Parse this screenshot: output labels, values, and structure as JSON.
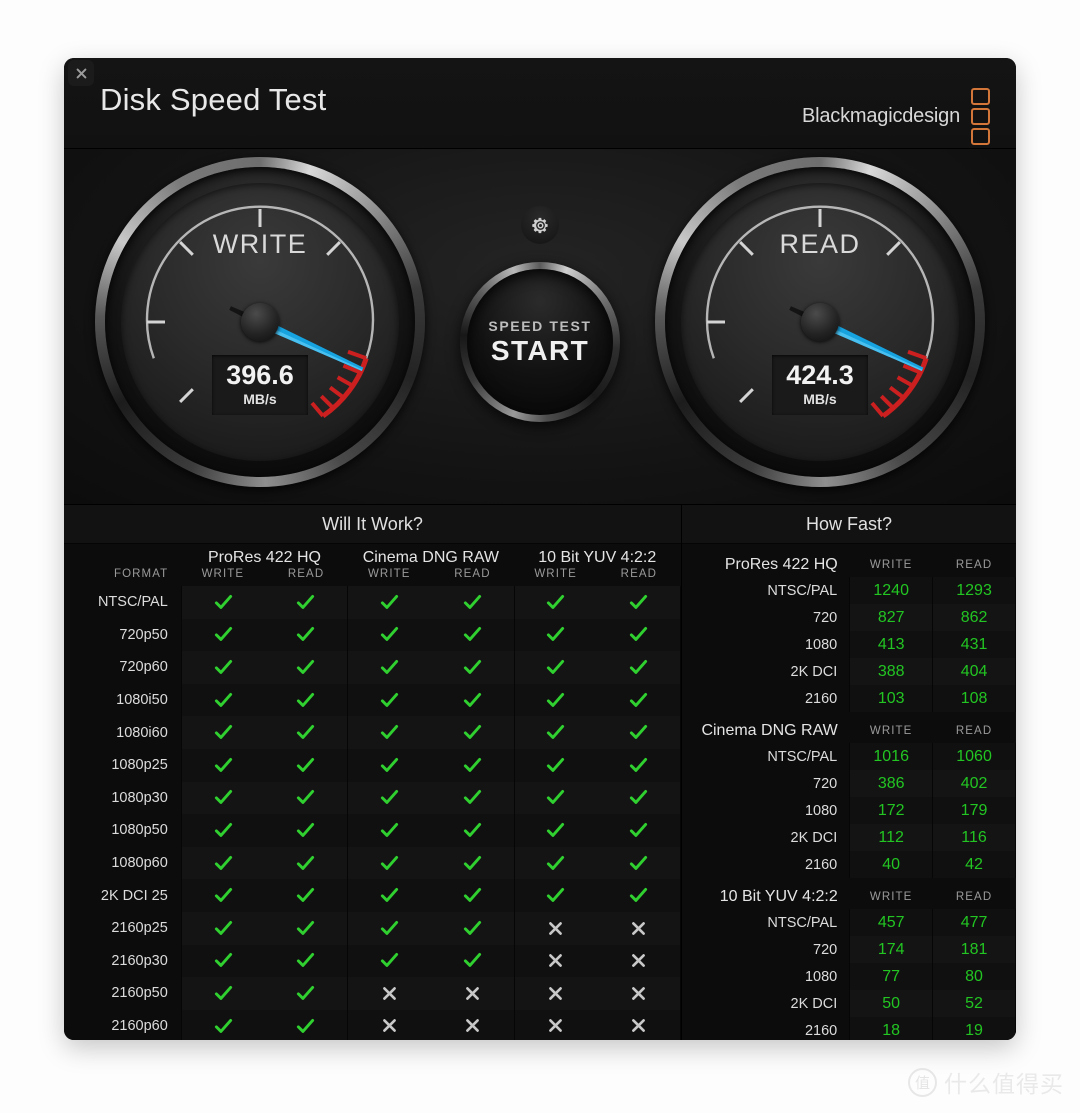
{
  "window": {
    "title": "Disk Speed Test",
    "close_icon": "close-icon",
    "brand": "Blackmagicdesign"
  },
  "gauges": {
    "write": {
      "label": "WRITE",
      "value": "396.6",
      "unit": "MB/s",
      "needle_angle": 205
    },
    "read": {
      "label": "READ",
      "value": "424.3",
      "unit": "MB/s",
      "needle_angle": 205
    }
  },
  "center": {
    "gear_icon": "gear-icon",
    "start_sub": "SPEED TEST",
    "start_main": "START"
  },
  "will_it_work": {
    "heading": "Will It Work?",
    "format_header": "FORMAT",
    "groups": [
      {
        "name": "ProRes 422 HQ",
        "write": "WRITE",
        "read": "READ"
      },
      {
        "name": "Cinema DNG RAW",
        "write": "WRITE",
        "read": "READ"
      },
      {
        "name": "10 Bit YUV 4:2:2",
        "write": "WRITE",
        "read": "READ"
      }
    ],
    "rows": [
      {
        "format": "NTSC/PAL",
        "marks": [
          1,
          1,
          1,
          1,
          1,
          1
        ]
      },
      {
        "format": "720p50",
        "marks": [
          1,
          1,
          1,
          1,
          1,
          1
        ]
      },
      {
        "format": "720p60",
        "marks": [
          1,
          1,
          1,
          1,
          1,
          1
        ]
      },
      {
        "format": "1080i50",
        "marks": [
          1,
          1,
          1,
          1,
          1,
          1
        ]
      },
      {
        "format": "1080i60",
        "marks": [
          1,
          1,
          1,
          1,
          1,
          1
        ]
      },
      {
        "format": "1080p25",
        "marks": [
          1,
          1,
          1,
          1,
          1,
          1
        ]
      },
      {
        "format": "1080p30",
        "marks": [
          1,
          1,
          1,
          1,
          1,
          1
        ]
      },
      {
        "format": "1080p50",
        "marks": [
          1,
          1,
          1,
          1,
          1,
          1
        ]
      },
      {
        "format": "1080p60",
        "marks": [
          1,
          1,
          1,
          1,
          1,
          1
        ]
      },
      {
        "format": "2K DCI 25",
        "marks": [
          1,
          1,
          1,
          1,
          1,
          1
        ]
      },
      {
        "format": "2160p25",
        "marks": [
          1,
          1,
          1,
          1,
          0,
          0
        ]
      },
      {
        "format": "2160p30",
        "marks": [
          1,
          1,
          1,
          1,
          0,
          0
        ]
      },
      {
        "format": "2160p50",
        "marks": [
          1,
          1,
          0,
          0,
          0,
          0
        ]
      },
      {
        "format": "2160p60",
        "marks": [
          1,
          1,
          0,
          0,
          0,
          0
        ]
      }
    ]
  },
  "how_fast": {
    "heading": "How Fast?",
    "sections": [
      {
        "name": "ProRes 422 HQ",
        "write_header": "WRITE",
        "read_header": "READ",
        "rows": [
          {
            "res": "NTSC/PAL",
            "write": "1240",
            "read": "1293"
          },
          {
            "res": "720",
            "write": "827",
            "read": "862"
          },
          {
            "res": "1080",
            "write": "413",
            "read": "431"
          },
          {
            "res": "2K DCI",
            "write": "388",
            "read": "404"
          },
          {
            "res": "2160",
            "write": "103",
            "read": "108"
          }
        ]
      },
      {
        "name": "Cinema DNG RAW",
        "write_header": "WRITE",
        "read_header": "READ",
        "rows": [
          {
            "res": "NTSC/PAL",
            "write": "1016",
            "read": "1060"
          },
          {
            "res": "720",
            "write": "386",
            "read": "402"
          },
          {
            "res": "1080",
            "write": "172",
            "read": "179"
          },
          {
            "res": "2K DCI",
            "write": "112",
            "read": "116"
          },
          {
            "res": "2160",
            "write": "40",
            "read": "42"
          }
        ]
      },
      {
        "name": "10 Bit YUV 4:2:2",
        "write_header": "WRITE",
        "read_header": "READ",
        "rows": [
          {
            "res": "NTSC/PAL",
            "write": "457",
            "read": "477"
          },
          {
            "res": "720",
            "write": "174",
            "read": "181"
          },
          {
            "res": "1080",
            "write": "77",
            "read": "80"
          },
          {
            "res": "2K DCI",
            "write": "50",
            "read": "52"
          },
          {
            "res": "2160",
            "write": "18",
            "read": "19"
          }
        ]
      }
    ]
  },
  "watermark": {
    "mark": "值",
    "text": "什么值得买"
  },
  "colors": {
    "accent_orange": "#d2763a",
    "needle_blue": "#16a3e0",
    "ok_green": "#22c522",
    "fail_gray": "#c8c8c8",
    "red_zone": "#cc1f1f"
  }
}
